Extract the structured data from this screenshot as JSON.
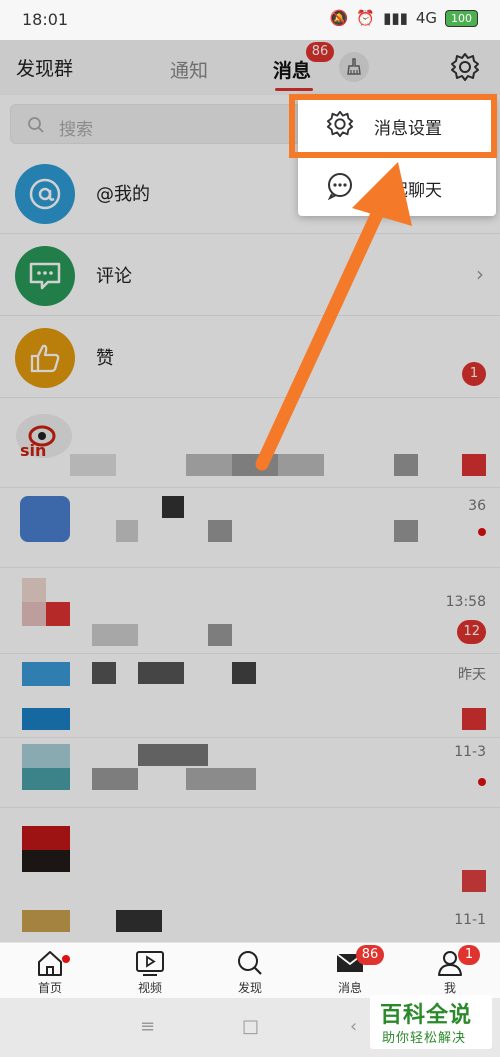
{
  "status_bar": {
    "time": "18:01",
    "network": "4G",
    "battery": "100"
  },
  "header": {
    "title": "发现群",
    "tabs": [
      {
        "label": "通知"
      },
      {
        "label": "消息",
        "badge": "86"
      }
    ],
    "broom_icon": "broom-icon",
    "settings_icon": "gear-icon"
  },
  "search": {
    "placeholder": "搜索"
  },
  "dropdown": {
    "items": [
      {
        "label": "消息设置",
        "icon": "gear-icon"
      },
      {
        "label": "发起聊天",
        "icon": "chat-bubble-icon"
      }
    ]
  },
  "list": {
    "fixed_items": [
      {
        "label": "@我的",
        "icon": "at-icon",
        "color": "#2e9bd6"
      },
      {
        "label": "评论",
        "icon": "comment-icon",
        "color": "#2a9a5a"
      },
      {
        "label": "赞",
        "icon": "thumb-up-icon",
        "color": "#e39a0e",
        "badge": "1"
      }
    ],
    "blurred_times": [
      "13:58",
      "昨天",
      "11-3",
      "11-1"
    ],
    "blurred_badges": [
      "12"
    ],
    "partial_text": "36"
  },
  "bottom_nav": {
    "items": [
      {
        "label": "首页",
        "icon": "home-icon"
      },
      {
        "label": "视频",
        "icon": "video-icon"
      },
      {
        "label": "发现",
        "icon": "search-icon"
      },
      {
        "label": "消息",
        "icon": "mail-icon",
        "badge": "86"
      },
      {
        "label": "我",
        "icon": "person-icon",
        "badge": "1"
      }
    ]
  },
  "system_nav": {
    "menu": "≡",
    "home": "□",
    "back": "‹"
  },
  "watermark": {
    "title": "百科全说",
    "subtitle": "助你轻松解决"
  },
  "colors": {
    "accent": "#e0332d",
    "highlight": "#f47a2a"
  }
}
